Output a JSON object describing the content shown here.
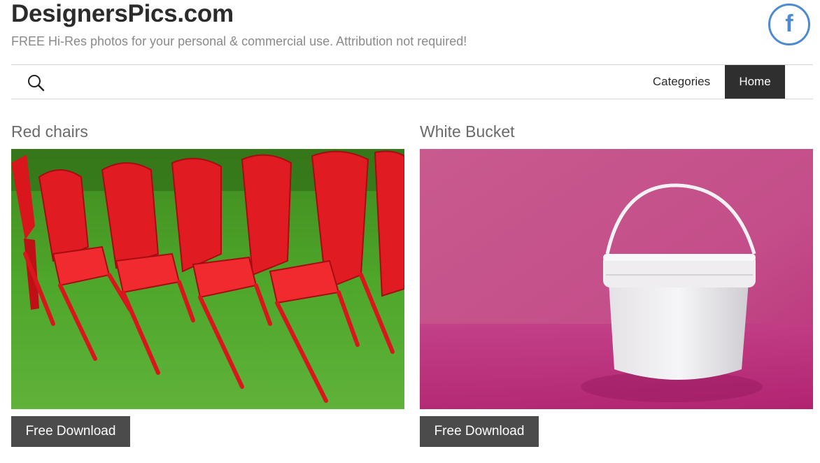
{
  "header": {
    "site_title": "DesignersPics.com",
    "tagline": "FREE Hi-Res photos for your personal & commercial use. Attribution not required!",
    "social_icon": "facebook-icon",
    "social_glyph": "f"
  },
  "nav": {
    "search_icon": "search-icon",
    "items": [
      {
        "label": "Categories"
      },
      {
        "label": "Home",
        "active": true
      }
    ]
  },
  "posts": [
    {
      "title": "Red chairs",
      "image": "red plastic chairs on green grass",
      "button_label": "Free Download"
    },
    {
      "title": "White Bucket",
      "image": "white bucket on pink background",
      "button_label": "Free Download"
    }
  ],
  "colors": {
    "brand_blue": "#4c8bd0",
    "nav_active_bg": "#2f2f2f",
    "button_bg": "#4b4b4b"
  }
}
